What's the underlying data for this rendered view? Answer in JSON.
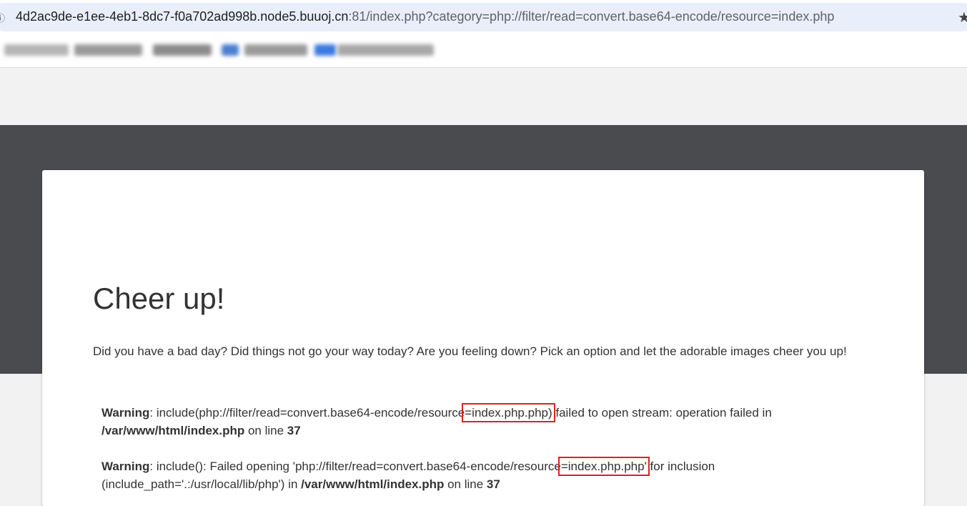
{
  "browser": {
    "site_icon": "site-info-icon",
    "url_host": "4d2ac9de-e1ee-4eb1-8dc7-f0a702ad998b.node5.buuoj.cn",
    "url_rest": ":81/index.php?category=php://filter/read=convert.base64-encode/resource=index.php",
    "star_icon": "★"
  },
  "page": {
    "title": "Cheer up!",
    "lead": "Did you have a bad day? Did things not go your way today? Are you feeling down? Pick an option and let the adorable images cheer you up!",
    "warnings": [
      {
        "label": "Warning",
        "text_a": ": include(php://filter/read=convert.base64-encode/resource",
        "highlight": "=index.php.php)",
        "text_b": " failed to open stream: operation failed in",
        "file": "/var/www/html/index.php",
        "online": " on line ",
        "line": "37"
      },
      {
        "label": "Warning",
        "text_a": ": include(): Failed opening 'php://filter/read=convert.base64-encode/resource",
        "highlight": "=index.php.php'",
        "text_b": " for inclusion",
        "text_c": "(include_path='.:/usr/local/lib/php') in ",
        "file": "/var/www/html/index.php",
        "online": " on line ",
        "line": "37"
      }
    ]
  },
  "colors": {
    "hero": "#4a4b4f",
    "page_bg": "#f2f2f2",
    "highlight_box": "#dd2222"
  }
}
